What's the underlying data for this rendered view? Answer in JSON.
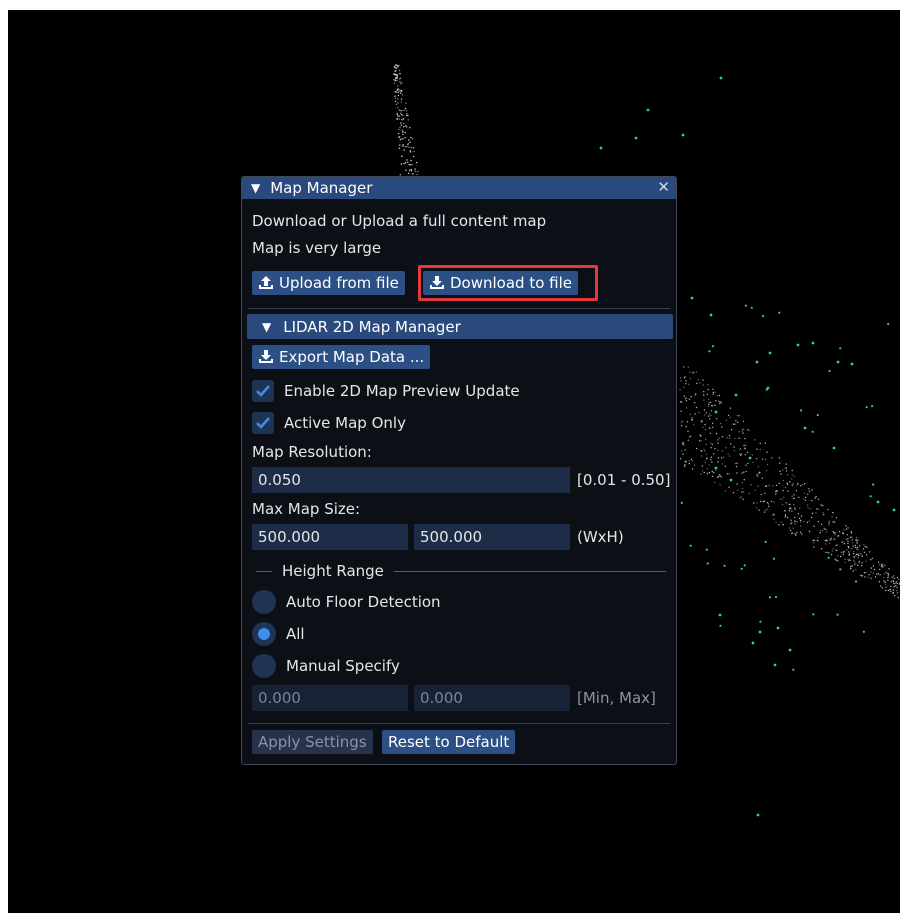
{
  "window": {
    "title": "Map Manager",
    "description_line1": "Download or Upload a full content map",
    "description_line2": "Map is very large",
    "upload_label": "Upload from file",
    "download_label": "Download to file"
  },
  "lidar": {
    "section_title": "LIDAR 2D Map Manager",
    "export_label": "Export Map Data ...",
    "enable_preview_label": "Enable 2D Map Preview Update",
    "enable_preview_checked": true,
    "active_only_label": "Active Map Only",
    "active_only_checked": true,
    "resolution_label": "Map Resolution:",
    "resolution_value": "0.050",
    "resolution_range": "[0.01 - 0.50]",
    "max_size_label": "Max Map Size:",
    "max_width": "500.000",
    "max_height": "500.000",
    "size_suffix": "(WxH)",
    "height_range_title": "Height Range",
    "radio_auto": "Auto Floor Detection",
    "radio_all": "All",
    "radio_manual": "Manual Specify",
    "selected_radio": "All",
    "min_value": "0.000",
    "max_value": "0.000",
    "minmax_suffix": "[Min, Max]",
    "apply_label": "Apply Settings",
    "reset_label": "Reset to Default"
  },
  "colors": {
    "accent": "#2c5085",
    "highlight": "#e0393e",
    "check": "#3d8ee8"
  }
}
